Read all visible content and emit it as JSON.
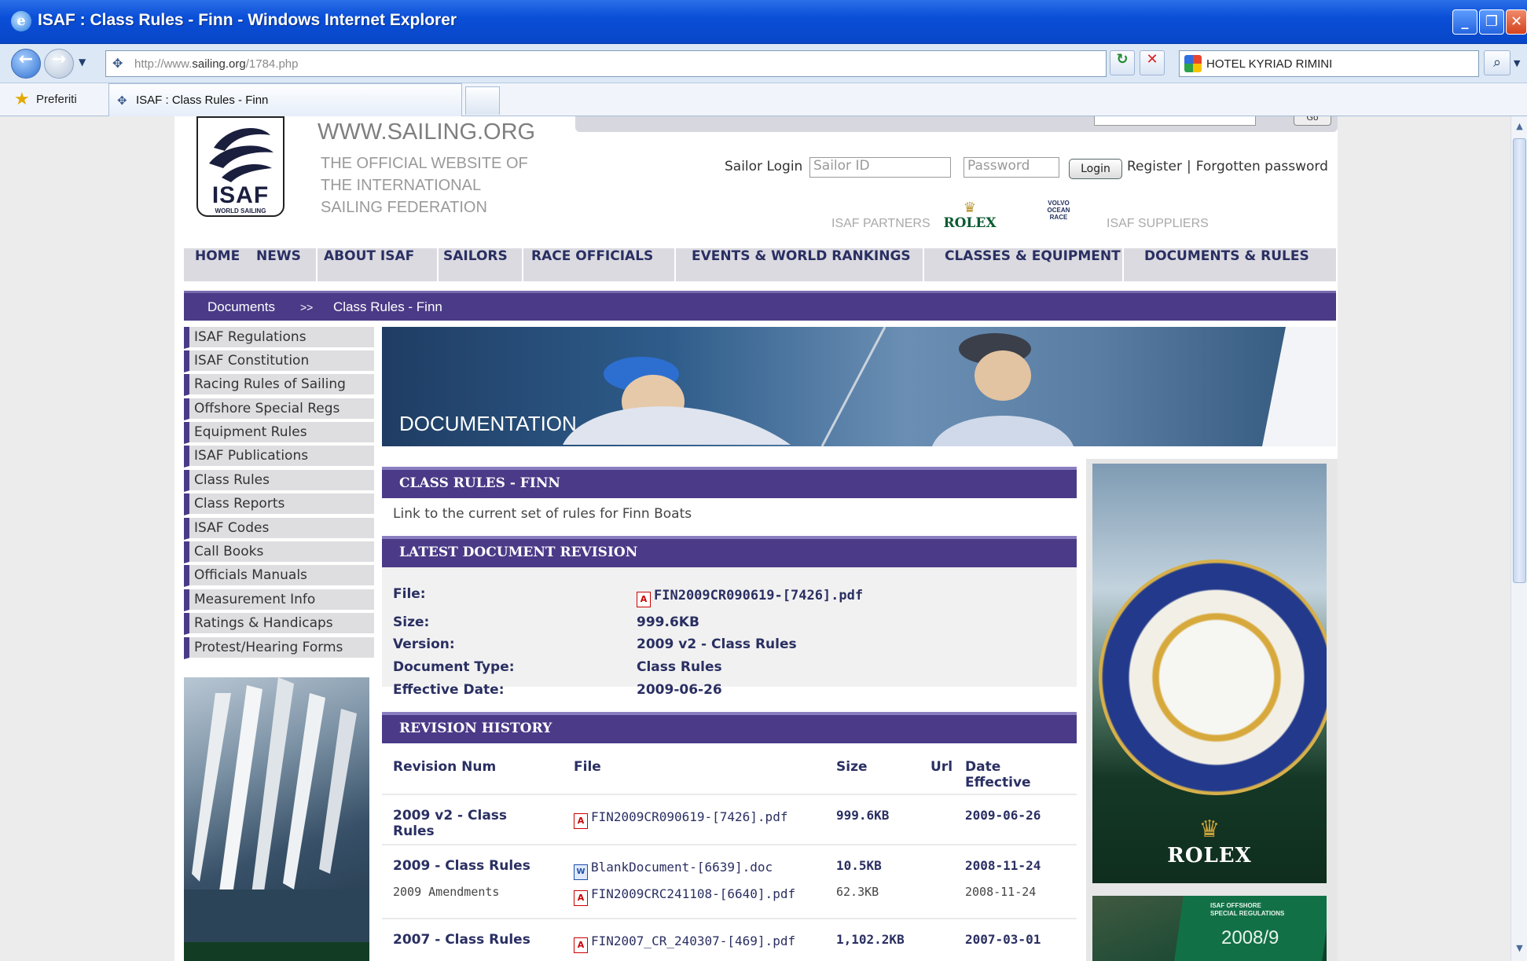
{
  "window": {
    "title": "ISAF : Class Rules - Finn - Windows Internet Explorer",
    "minimize": "_",
    "maximize": "❐",
    "close": "✕"
  },
  "addressbar": {
    "url_prefix": "http://www.",
    "url_domain": "sailing.org",
    "url_path": "/1784.php",
    "search_value": "HOTEL KYRIAD RIMINI"
  },
  "favorites": {
    "label": "Preferiti",
    "tab_title": "ISAF : Class Rules - Finn"
  },
  "site": {
    "url_heading": "WWW.SAILING.ORG",
    "tagline_lines": [
      "THE OFFICIAL WEBSITE OF",
      "THE INTERNATIONAL",
      "SAILING FEDERATION"
    ],
    "logo_word": "ISAF",
    "logo_sub": "WORLD SAILING",
    "top_go": "Go"
  },
  "login": {
    "label": "Sailor Login",
    "id_placeholder": "Sailor ID",
    "password_placeholder": "Password",
    "button": "Login",
    "register": "Register",
    "forgotten": "Forgotten password"
  },
  "partners": {
    "partners_label": "ISAF PARTNERS",
    "rolex": "ROLEX",
    "volvo": "VOLVO OCEAN RACE",
    "suppliers_label": "ISAF SUPPLIERS"
  },
  "mainnav": [
    "HOME",
    "NEWS",
    "ABOUT ISAF",
    "SAILORS",
    "RACE OFFICIALS",
    "EVENTS & WORLD RANKINGS",
    "CLASSES & EQUIPMENT",
    "DOCUMENTS & RULES"
  ],
  "breadcrumb": {
    "root": "Documents",
    "separator": ">>",
    "current": "Class Rules - Finn"
  },
  "leftmenu": [
    "ISAF Regulations",
    "ISAF Constitution",
    "Racing Rules of Sailing",
    "Offshore Special Regs",
    "Equipment Rules",
    "ISAF Publications",
    "Class Rules",
    "Class Reports",
    "ISAF Codes",
    "Call Books",
    "Officials Manuals",
    "Measurement Info",
    "Ratings & Handicaps",
    "Protest/Hearing Forms"
  ],
  "banner": {
    "title": "DOCUMENTATION"
  },
  "class_rules": {
    "heading": "CLASS RULES - FINN",
    "description": "Link to the current set of rules for Finn Boats"
  },
  "latest": {
    "heading": "LATEST DOCUMENT REVISION",
    "file_label": "File:",
    "file_value": "FIN2009CR090619-[7426].pdf",
    "size_label": "Size:",
    "size_value": "999.6KB",
    "version_label": "Version:",
    "version_value": "2009 v2 - Class Rules",
    "doctype_label": "Document Type:",
    "doctype_value": "Class Rules",
    "effective_label": "Effective Date:",
    "effective_value": "2009-06-26"
  },
  "history": {
    "heading": "REVISION HISTORY",
    "columns": {
      "revision": "Revision Num",
      "file": "File",
      "size": "Size",
      "url": "Url",
      "date_line1": "Date",
      "date_line2": "Effective"
    },
    "rows": [
      {
        "revision_line1": "2009 v2 - Class",
        "revision_line2": "Rules",
        "file": "FIN2009CR090619-[7426].pdf",
        "size": "999.6KB",
        "date": "2009-06-26"
      },
      {
        "revision": "2009 - Class Rules",
        "file": "BlankDocument-[6639].doc",
        "size": "10.5KB",
        "date": "2008-11-24",
        "sub_revision": "2009 Amendments",
        "sub_file": "FIN2009CRC241108-[6640].pdf",
        "sub_size": "62.3KB",
        "sub_date": "2008-11-24"
      },
      {
        "revision": "2007 - Class Rules",
        "file": "FIN2007_CR_240307-[469].pdf",
        "size": "1,102.2KB",
        "date": "2007-03-01"
      }
    ]
  },
  "ads": {
    "rolex_word": "ROLEX",
    "book_line1": "ISAF OFFSHORE",
    "book_line2": "SPECIAL REGULATIONS",
    "book_year": "2008/9"
  },
  "colors": {
    "brand_purple": "#4b3a87",
    "nav_text": "#2a2f62",
    "titlebar_blue": "#0a4fd8"
  }
}
